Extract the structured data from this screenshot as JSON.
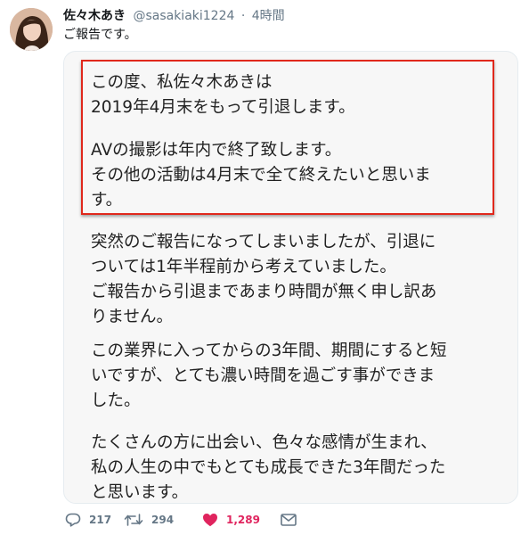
{
  "tweet": {
    "display_name": "佐々木あき",
    "handle": "@sasakiaki1224",
    "separator": "·",
    "time": "4時間",
    "text": "ご報告です。"
  },
  "image_text": {
    "highlighted": {
      "para1": [
        "この度、私佐々木あきは",
        "2019年4月末をもって引退します。"
      ],
      "para2": [
        "AVの撮影は年内で終了致します。",
        "その他の活動は4月末で全て終えたいと思いま",
        "す。"
      ]
    },
    "para3": [
      "突然のご報告になってしまいましたが、引退に",
      "ついては1年半程前から考えていました。",
      "ご報告から引退まであまり時間が無く申し訳あ",
      "りません。"
    ],
    "para4": [
      "この業界に入ってからの3年間、期間にすると短",
      "いですが、とても濃い時間を過ごす事ができま",
      "した。"
    ],
    "para5": [
      "たくさんの方に出会い、色々な感情が生まれ、",
      "私の人生の中でもとても成長できた3年間だった",
      "と思います。"
    ]
  },
  "actions": {
    "reply": {
      "icon": "reply-icon",
      "count": "217"
    },
    "retweet": {
      "icon": "retweet-icon",
      "count": "294"
    },
    "like": {
      "icon": "heart-icon",
      "count": "1,289",
      "color": "#e0245e"
    },
    "dm": {
      "icon": "envelope-icon"
    }
  },
  "colors": {
    "highlight_border": "#e0281c",
    "secondary_text": "#657786",
    "like_active": "#e0245e"
  }
}
